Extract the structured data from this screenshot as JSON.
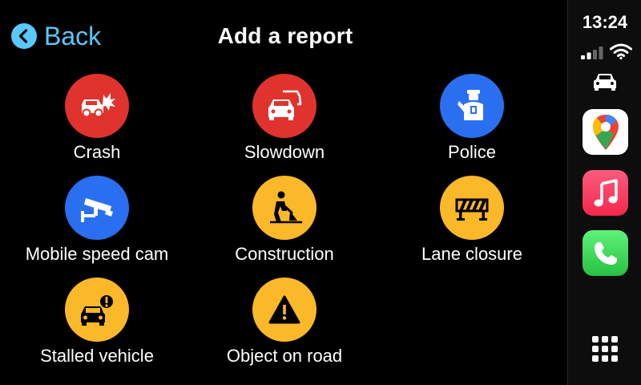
{
  "header": {
    "back_label": "Back",
    "title": "Add a report"
  },
  "reports": [
    {
      "label": "Crash",
      "icon": "crash-icon",
      "color": "#e0332d"
    },
    {
      "label": "Slowdown",
      "icon": "slowdown-icon",
      "color": "#e0332d"
    },
    {
      "label": "Police",
      "icon": "police-icon",
      "color": "#2a6ff0"
    },
    {
      "label": "Mobile speed cam",
      "icon": "speed-camera-icon",
      "color": "#2a6ff0"
    },
    {
      "label": "Construction",
      "icon": "construction-worker-icon",
      "color": "#fbb829"
    },
    {
      "label": "Lane closure",
      "icon": "lane-closure-barrier-icon",
      "color": "#fbb829"
    },
    {
      "label": "Stalled vehicle",
      "icon": "stalled-vehicle-icon",
      "color": "#fbb829"
    },
    {
      "label": "Object on road",
      "icon": "warning-triangle-icon",
      "color": "#fbb829"
    }
  ],
  "status_bar": {
    "time": "13:24",
    "icons": [
      "cellular-signal-icon",
      "wifi-icon",
      "car-icon"
    ]
  },
  "dock": {
    "apps": [
      "google-maps-app-icon",
      "music-app-icon",
      "phone-app-icon"
    ],
    "colors": {
      "maps": "#ffffff",
      "music": "#fa2d48",
      "phone": "#34c759"
    }
  },
  "colors": {
    "accent": "#5ac8fa",
    "background": "#000000"
  }
}
